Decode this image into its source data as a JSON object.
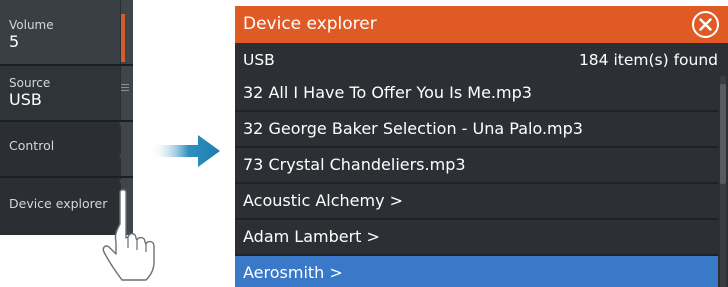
{
  "menu": {
    "volume": {
      "label": "Volume",
      "value": "5"
    },
    "source": {
      "label": "Source",
      "value": "USB"
    },
    "control": {
      "label": "Control"
    },
    "device_explorer": {
      "label": "Device explorer"
    }
  },
  "explorer": {
    "title": "Device explorer",
    "source": "USB",
    "count_text": "184 item(s) found",
    "items": [
      "32 All I Have To Offer You Is Me.mp3",
      "32 George Baker Selection - Una Palo.mp3",
      "73 Crystal Chandeliers.mp3",
      "Acoustic Alchemy >",
      "Adam Lambert >",
      "Aerosmith >"
    ],
    "selected_item": "Aerosmith >"
  },
  "colors": {
    "title_bar": "#e05a26",
    "panel_bg": "#2c3035",
    "selected_row": "#3a78c8",
    "arrow": "#2f8fc0",
    "menu_accent": "#d15c2c"
  },
  "icons": [
    "close-icon",
    "arrow-right-icon",
    "hand-pointer-icon",
    "grip-icon",
    "chevron-right-icon"
  ]
}
